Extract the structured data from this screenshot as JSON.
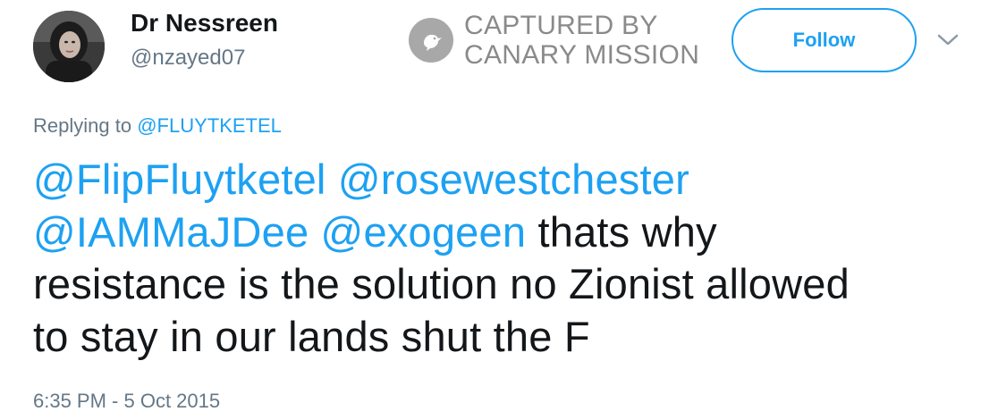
{
  "author": {
    "display_name": "Dr Nessreen",
    "handle": "@nzayed07"
  },
  "watermark": {
    "line1": "CAPTURED BY",
    "line2": "CANARY MISSION",
    "icon": "canary-bird-icon"
  },
  "follow_button": {
    "label": "Follow"
  },
  "menu": {
    "icon": "chevron-down-icon"
  },
  "reply_context": {
    "prefix": "Replying to ",
    "mention": "@FLUYTKETEL"
  },
  "tweet": {
    "mentions": [
      "@FlipFluytketel",
      "@rosewestchester",
      "@IAMMaJDee",
      "@exogeen"
    ],
    "line2_text": "thats why",
    "line3_text": "resistance is the solution no Zionist allowed",
    "line4_text": "to stay in our lands shut the F",
    "timestamp": "6:35 PM - 5 Oct 2015"
  },
  "colors": {
    "link_blue": "#1da1f2",
    "secondary_gray": "#657786",
    "text_dark": "#14171a",
    "watermark_gray": "#8a8a8a"
  }
}
